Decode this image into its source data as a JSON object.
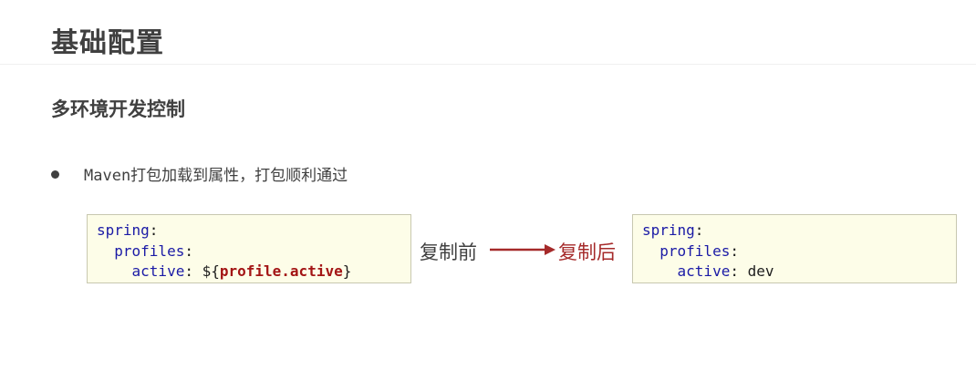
{
  "page": {
    "title": "基础配置",
    "section_heading": "多环境开发控制"
  },
  "bullet": {
    "text": "Maven打包加载到属性，打包顺利通过"
  },
  "before": {
    "label": "复制前",
    "code": {
      "l1_key": "spring",
      "l1_punct": ":",
      "l2_key": "profiles",
      "l2_punct": ":",
      "l3_key": "active",
      "l3_sep": ": ${",
      "l3_var": "profile.active",
      "l3_end": "}"
    }
  },
  "after": {
    "label": "复制后",
    "code": {
      "l1_key": "spring",
      "l1_punct": ":",
      "l2_key": "profiles",
      "l2_punct": ":",
      "l3_key": "active",
      "l3_sep": ": ",
      "l3_value": "dev"
    }
  },
  "colors": {
    "yaml_key": "#1a1aa6",
    "placeholder": "#a31515",
    "arrow": "#a52a2a",
    "code_bg": "#fdfde8"
  }
}
